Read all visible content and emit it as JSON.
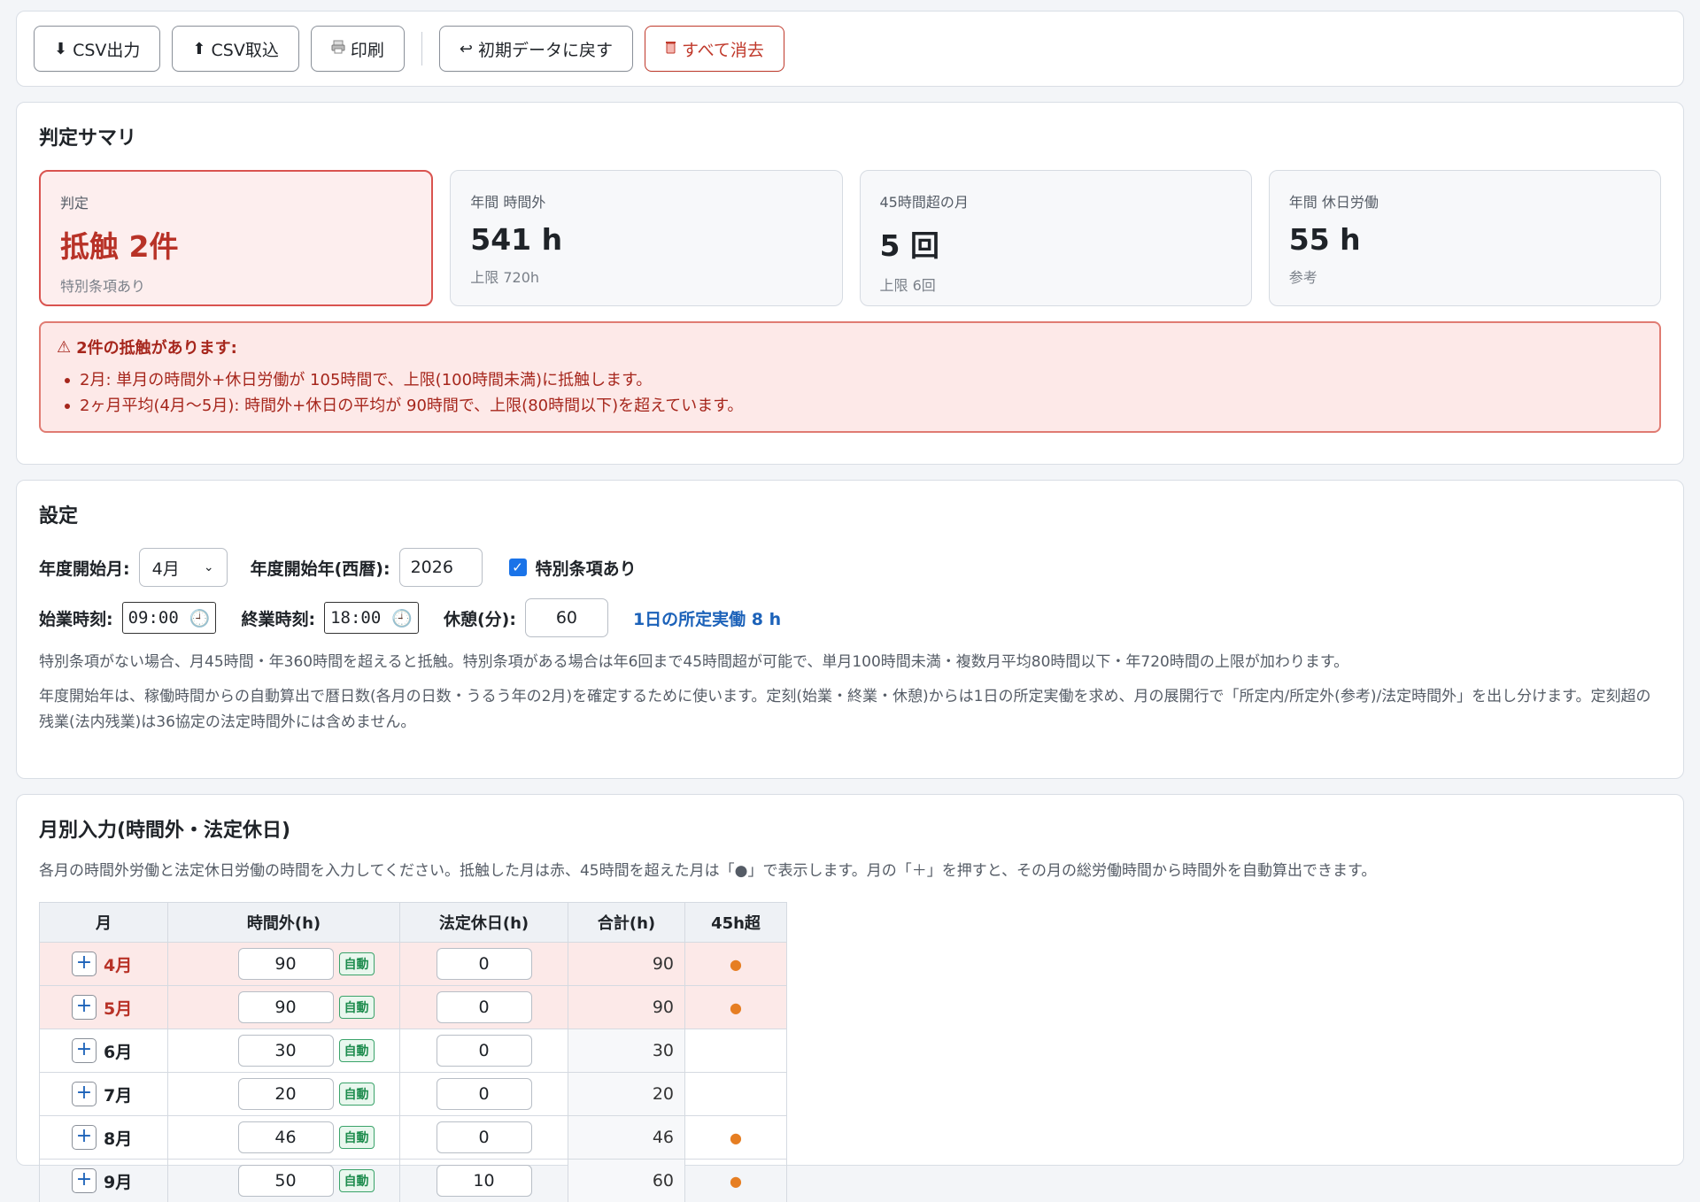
{
  "toolbar": {
    "csv_export": "CSV出力",
    "csv_import": "CSV取込",
    "print": "印刷",
    "reset": "初期データに戻す",
    "clear_all": "すべて消去"
  },
  "summary": {
    "title": "判定サマリ",
    "kpis": [
      {
        "label": "判定",
        "value": "抵触 2件",
        "sub": "特別条項あり"
      },
      {
        "label": "年間 時間外",
        "value": "541 h",
        "sub": "上限 720h"
      },
      {
        "label": "45時間超の月",
        "value": "5 回",
        "sub": "上限 6回"
      },
      {
        "label": "年間 休日労働",
        "value": "55 h",
        "sub": "参考"
      }
    ],
    "alert_title": "2件の抵触があります:",
    "alerts": [
      "2月: 単月の時間外+休日労働が 105時間で、上限(100時間未満)に抵触します。",
      "2ヶ月平均(4月〜5月): 時間外+休日の平均が 90時間で、上限(80時間以下)を超えています。"
    ]
  },
  "settings": {
    "title": "設定",
    "start_month_label": "年度開始月:",
    "start_month_value": "4月",
    "start_year_label": "年度開始年(西暦):",
    "start_year_value": "2026",
    "special_clause_label": "特別条項あり",
    "start_time_label": "始業時刻:",
    "start_time_value": "09:00",
    "end_time_label": "終業時刻:",
    "end_time_value": "18:00",
    "break_label": "休憩(分):",
    "break_value": "60",
    "daily_info": "1日の所定実働 8 h",
    "note1": "特別条項がない場合、月45時間・年360時間を超えると抵触。特別条項がある場合は年6回まで45時間超が可能で、単月100時間未満・複数月平均80時間以下・年720時間の上限が加わります。",
    "note2": "年度開始年は、稼働時間からの自動算出で暦日数(各月の日数・うるう年の2月)を確定するために使います。定刻(始業・終業・休憩)からは1日の所定実働を求め、月の展開行で「所定内/所定外(参考)/法定時間外」を出し分けます。定刻超の残業(法内残業)は36協定の法定時間外には含めません。"
  },
  "monthly": {
    "title": "月別入力(時間外・法定休日)",
    "desc": "各月の時間外労働と法定休日労働の時間を入力してください。抵触した月は赤、45時間を超えた月は「●」で表示します。月の「＋」を押すと、その月の総労働時間から時間外を自動算出できます。",
    "headers": [
      "月",
      "時間外(h)",
      "法定休日(h)",
      "合計(h)",
      "45h超"
    ],
    "auto_label": "自動",
    "rows": [
      {
        "month": "4月",
        "overtime": "90",
        "holiday": "0",
        "total": "90",
        "over45": "●",
        "violation": true
      },
      {
        "month": "5月",
        "overtime": "90",
        "holiday": "0",
        "total": "90",
        "over45": "●",
        "violation": true
      },
      {
        "month": "6月",
        "overtime": "30",
        "holiday": "0",
        "total": "30",
        "over45": "",
        "violation": false
      },
      {
        "month": "7月",
        "overtime": "20",
        "holiday": "0",
        "total": "20",
        "over45": "",
        "violation": false
      },
      {
        "month": "8月",
        "overtime": "46",
        "holiday": "0",
        "total": "46",
        "over45": "●",
        "violation": false
      },
      {
        "month": "9月",
        "overtime": "50",
        "holiday": "10",
        "total": "60",
        "over45": "●",
        "violation": false
      }
    ]
  }
}
